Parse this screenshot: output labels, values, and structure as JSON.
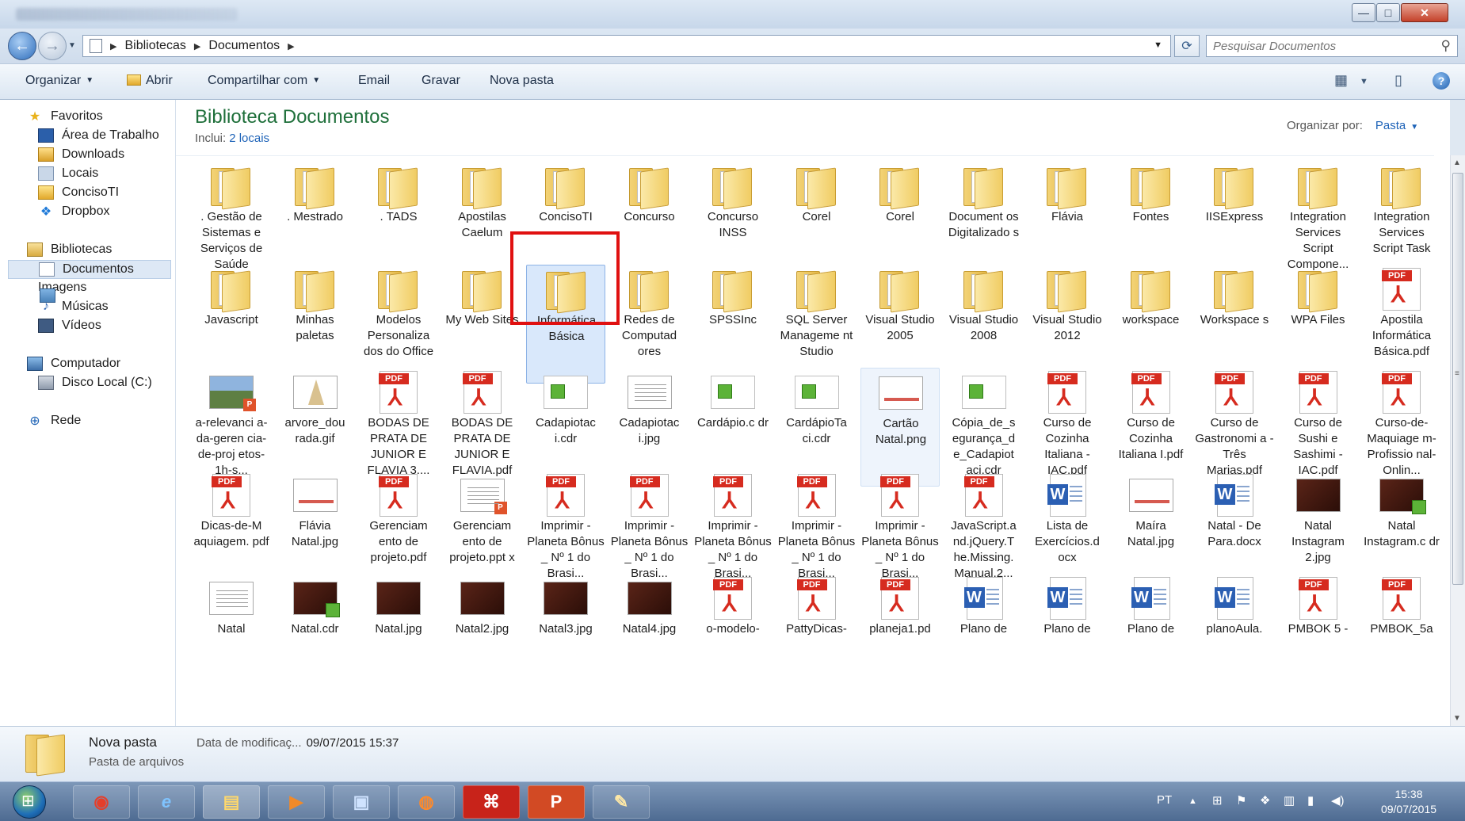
{
  "window": {
    "close_glyph": "✕",
    "max_glyph": "□",
    "min_glyph": "—"
  },
  "address": {
    "crumbs": [
      "Bibliotecas",
      "Documentos"
    ],
    "search_placeholder": "Pesquisar Documentos"
  },
  "toolbar": {
    "organize": "Organizar",
    "open": "Abrir",
    "share": "Compartilhar com",
    "email": "Email",
    "burn": "Gravar",
    "new_folder": "Nova pasta"
  },
  "sidebar": {
    "favorites": "Favoritos",
    "fav_items": [
      "Área de Trabalho",
      "Downloads",
      "Locais",
      "ConcisoTI",
      "Dropbox"
    ],
    "libraries": "Bibliotecas",
    "lib_items": [
      "Documentos",
      "Imagens",
      "Músicas",
      "Vídeos"
    ],
    "computer": "Computador",
    "computer_items": [
      "Disco Local (C:)"
    ],
    "network": "Rede"
  },
  "library": {
    "title": "Biblioteca Documentos",
    "includes_label": "Inclui:",
    "includes_link": "2 locais",
    "arrange_label": "Organizar por:",
    "arrange_value": "Pasta"
  },
  "items": [
    {
      "label": ". Gestão de Sistemas e Serviços de Saúde",
      "icon": "folder"
    },
    {
      "label": ". Mestrado",
      "icon": "folder"
    },
    {
      "label": ". TADS",
      "icon": "folder"
    },
    {
      "label": "Apostilas Caelum",
      "icon": "folder"
    },
    {
      "label": "ConcisoTI",
      "icon": "folder"
    },
    {
      "label": "Concurso",
      "icon": "folder"
    },
    {
      "label": "Concurso INSS",
      "icon": "folder"
    },
    {
      "label": "Corel",
      "icon": "folder"
    },
    {
      "label": "Corel",
      "icon": "folder"
    },
    {
      "label": "Document os Digitalizado s",
      "icon": "folder"
    },
    {
      "label": "Flávia",
      "icon": "folder"
    },
    {
      "label": "Fontes",
      "icon": "folder"
    },
    {
      "label": "IISExpress",
      "icon": "folder"
    },
    {
      "label": "Integration Services Script Compone...",
      "icon": "folder"
    },
    {
      "label": "Integration Services Script Task",
      "icon": "folder"
    },
    {
      "label": "Javascript",
      "icon": "folder"
    },
    {
      "label": "Minhas paletas",
      "icon": "folder"
    },
    {
      "label": "Modelos Personaliza dos do Office",
      "icon": "folder"
    },
    {
      "label": "My Web Sites",
      "icon": "folder"
    },
    {
      "label": "Informática Básica",
      "icon": "folder",
      "selected": true
    },
    {
      "label": "Redes de Computad ores",
      "icon": "folder"
    },
    {
      "label": "SPSSInc",
      "icon": "folder"
    },
    {
      "label": "SQL Server Manageme nt Studio",
      "icon": "folder"
    },
    {
      "label": "Visual Studio 2005",
      "icon": "folder"
    },
    {
      "label": "Visual Studio 2008",
      "icon": "folder"
    },
    {
      "label": "Visual Studio 2012",
      "icon": "folder"
    },
    {
      "label": "workspace",
      "icon": "folder"
    },
    {
      "label": "Workspace s",
      "icon": "folder"
    },
    {
      "label": "WPA Files",
      "icon": "folder"
    },
    {
      "label": "Apostila Informática Básica.pdf",
      "icon": "pdf"
    },
    {
      "label": "a-relevanci a-da-geren cia-de-proj etos-1h-s...",
      "icon": "img-land-ppt"
    },
    {
      "label": "arvore_dou rada.gif",
      "icon": "img-tree"
    },
    {
      "label": "BODAS DE PRATA DE JUNIOR E FLAVIA 3....",
      "icon": "pdf"
    },
    {
      "label": "BODAS DE PRATA DE JUNIOR E FLAVIA.pdf",
      "icon": "pdf"
    },
    {
      "label": "Cadapiotac i.cdr",
      "icon": "img-cdr"
    },
    {
      "label": "Cadapiotac i.jpg",
      "icon": "img-doc"
    },
    {
      "label": "Cardápio.c dr",
      "icon": "img-cdr"
    },
    {
      "label": "CardápioTa ci.cdr",
      "icon": "img-cdr"
    },
    {
      "label": "Cartão Natal.png",
      "icon": "img-red",
      "hover": true
    },
    {
      "label": "Cópia_de_s egurança_d e_Cadapiot aci.cdr",
      "icon": "img-cdr"
    },
    {
      "label": "Curso de Cozinha Italiana - IAC.pdf",
      "icon": "pdf"
    },
    {
      "label": "Curso de Cozinha Italiana I.pdf",
      "icon": "pdf"
    },
    {
      "label": "Curso de Gastronomi a - Três Marias.pdf",
      "icon": "pdf"
    },
    {
      "label": "Curso de Sushi e Sashimi - IAC.pdf",
      "icon": "pdf"
    },
    {
      "label": "Curso-de- Maquiage m-Profissio nal-Onlin...",
      "icon": "pdf"
    },
    {
      "label": "Dicas-de-M aquiagem. pdf",
      "icon": "pdf"
    },
    {
      "label": "Flávia Natal.jpg",
      "icon": "img-red"
    },
    {
      "label": "Gerenciam ento de projeto.pdf",
      "icon": "pdf"
    },
    {
      "label": "Gerenciam ento de projeto.ppt x",
      "icon": "img-ppt"
    },
    {
      "label": "Imprimir - Planeta Bônus _ Nº 1 do Brasi...",
      "icon": "pdf"
    },
    {
      "label": "Imprimir - Planeta Bônus _ Nº 1 do Brasi...",
      "icon": "pdf"
    },
    {
      "label": "Imprimir - Planeta Bônus _ Nº 1 do Brasi...",
      "icon": "pdf"
    },
    {
      "label": "Imprimir - Planeta Bônus _ Nº 1 do Brasi...",
      "icon": "pdf"
    },
    {
      "label": "Imprimir - Planeta Bônus _ Nº 1 do Brasi...",
      "icon": "pdf"
    },
    {
      "label": "JavaScript.a nd.jQuery.T he.Missing. Manual.2...",
      "icon": "pdf"
    },
    {
      "label": "Lista de Exercícios.d ocx",
      "icon": "word"
    },
    {
      "label": "Maíra Natal.jpg",
      "icon": "img-red"
    },
    {
      "label": "Natal - De Para.docx",
      "icon": "word"
    },
    {
      "label": "Natal Instagram 2.jpg",
      "icon": "img-dark"
    },
    {
      "label": "Natal Instagram.c dr",
      "icon": "img-dark-cdr"
    },
    {
      "label": "Natal",
      "icon": "img-doc"
    },
    {
      "label": "Natal.cdr",
      "icon": "img-dark-cdr"
    },
    {
      "label": "Natal.jpg",
      "icon": "img-dark"
    },
    {
      "label": "Natal2.jpg",
      "icon": "img-dark"
    },
    {
      "label": "Natal3.jpg",
      "icon": "img-dark"
    },
    {
      "label": "Natal4.jpg",
      "icon": "img-dark"
    },
    {
      "label": "o-modelo-",
      "icon": "pdf"
    },
    {
      "label": "PattyDicas-",
      "icon": "pdf"
    },
    {
      "label": "planeja1.pd",
      "icon": "pdf"
    },
    {
      "label": "Plano de",
      "icon": "word"
    },
    {
      "label": "Plano de",
      "icon": "word"
    },
    {
      "label": "Plano de",
      "icon": "word"
    },
    {
      "label": "planoAula.",
      "icon": "word"
    },
    {
      "label": "PMBOK 5 -",
      "icon": "pdf"
    },
    {
      "label": "PMBOK_5a",
      "icon": "pdf"
    }
  ],
  "details": {
    "name": "Nova pasta",
    "type": "Pasta de arquivos",
    "modified_label": "Data de modificaç...",
    "modified_value": "09/07/2015 15:37"
  },
  "taskbar": {
    "lang": "PT",
    "time": "15:38",
    "date": "09/07/2015",
    "apps": [
      "chrome",
      "ie",
      "explorer",
      "media",
      "rdp",
      "firefox",
      "acrobat",
      "powerpoint",
      "paint"
    ]
  }
}
